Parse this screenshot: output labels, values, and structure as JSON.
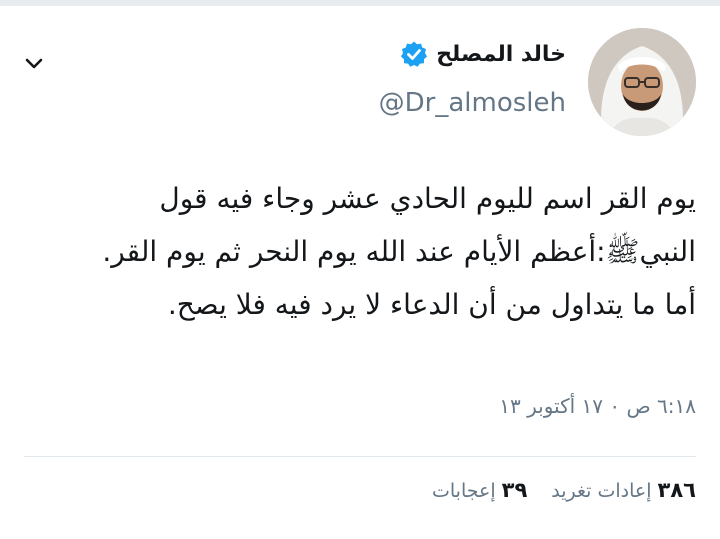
{
  "author": {
    "display_name": "خالد المصلح",
    "handle": "@Dr_almosleh",
    "verified": true
  },
  "tweet": {
    "paragraphs": [
      "يوم القر اسم لليوم الحادي عشر وجاء فيه قول النبيﷺ:أعظم الأيام عند الله يوم النحر ثم يوم القر.",
      "أما ما يتداول من أن الدعاء لا يرد فيه فلا يصح."
    ],
    "timestamp": "٦:١٨ ص ٠ ١٧ أكتوبر ١٣"
  },
  "stats": {
    "retweets_count": "٣٨٦",
    "retweets_label": "إعادات تغريد",
    "likes_count": "٣٩",
    "likes_label": "إعجابات"
  },
  "colors": {
    "verified": "#1da1f2",
    "secondary_text": "#657786",
    "divider": "#e1e8ed"
  },
  "icons": {
    "menu": "chevron-down-icon",
    "verified": "verified-badge-icon"
  }
}
